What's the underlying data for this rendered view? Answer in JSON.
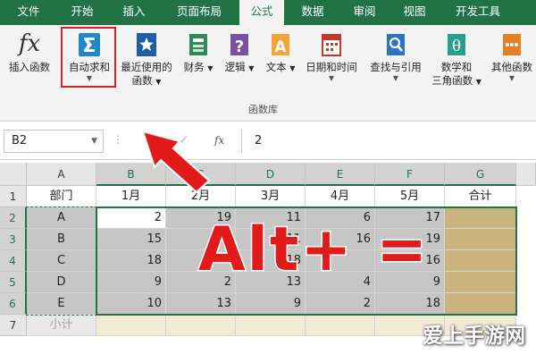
{
  "ribbon_tabs": [
    "文件",
    "开始",
    "插入",
    "页面布局",
    "公式",
    "数据",
    "审阅",
    "视图",
    "开发工具"
  ],
  "active_tab": "公式",
  "ribbon": {
    "insert_function": "插入函数",
    "autosum": "自动求和",
    "recent_line1": "最近使用的",
    "recent_line2": "函数",
    "financial": "财务",
    "logical": "逻辑",
    "text": "文本",
    "datetime": "日期和时间",
    "lookup": "查找与引用",
    "math_line1": "数学和",
    "math_line2": "三角函数",
    "other": "其他函数",
    "group_label": "函数库"
  },
  "formula_bar": {
    "name_box": "B2",
    "fx_label": "fx",
    "value": "2"
  },
  "grid": {
    "columns": [
      "A",
      "B",
      "C",
      "D",
      "E",
      "F",
      "G"
    ],
    "rows": [
      "1",
      "2",
      "3",
      "4",
      "5",
      "6",
      "7"
    ],
    "header_row": [
      "部门",
      "1月",
      "2月",
      "3月",
      "4月",
      "5月",
      "合计"
    ],
    "data_rows": [
      [
        "A",
        "2",
        "19",
        "11",
        "6",
        "17",
        ""
      ],
      [
        "B",
        "15",
        "",
        "11",
        "16",
        "19",
        ""
      ],
      [
        "C",
        "18",
        "",
        "18",
        "",
        "16",
        ""
      ],
      [
        "D",
        "9",
        "2",
        "13",
        "4",
        "9",
        ""
      ],
      [
        "E",
        "10",
        "13",
        "9",
        "2",
        "18",
        ""
      ]
    ],
    "subtotal_label": "小计"
  },
  "overlay": {
    "shortcut": "Alt+ ="
  },
  "watermark": "爱上手游网",
  "colors": {
    "tab_bar": "#217346",
    "selection_border": "#217346",
    "total_column": "#c9b47e",
    "subtotal_row": "#f2ead3",
    "annotation_red": "#e21a1a"
  }
}
